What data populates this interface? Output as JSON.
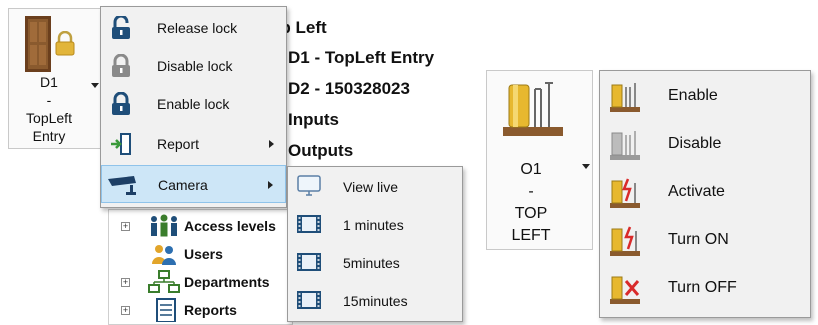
{
  "left": {
    "device_tile": {
      "label_lines": [
        "D1",
        "-",
        "TopLeft",
        "Entry"
      ]
    },
    "details": {
      "lines": [
        "op Left",
        "D1 - TopLeft Entry",
        "D2 - 150328023",
        "Inputs",
        "Outputs"
      ]
    },
    "lock_menu": {
      "items": [
        {
          "label": "Release lock",
          "icon": "lock-open-icon",
          "has_submenu": false
        },
        {
          "label": "Disable lock",
          "icon": "lock-disabled-icon",
          "has_submenu": false
        },
        {
          "label": "Enable lock",
          "icon": "lock-icon",
          "has_submenu": false
        },
        {
          "label": "Report",
          "icon": "report-door-icon",
          "has_submenu": true
        },
        {
          "label": "Camera",
          "icon": "camera-icon",
          "has_submenu": true,
          "selected": true
        }
      ]
    },
    "tree": {
      "items": [
        {
          "label": "Access levels",
          "icon": "people-icon",
          "expandable": true
        },
        {
          "label": "Users",
          "icon": "users-icon",
          "expandable": false
        },
        {
          "label": "Departments",
          "icon": "departments-icon",
          "expandable": true
        },
        {
          "label": "Reports",
          "icon": "reports-icon",
          "expandable": true
        }
      ]
    },
    "camera_menu": {
      "items": [
        {
          "label": "View live",
          "icon": "monitor-icon"
        },
        {
          "label": "1 minutes",
          "icon": "film-icon"
        },
        {
          "label": "5minutes",
          "icon": "film-icon"
        },
        {
          "label": "15minutes",
          "icon": "film-icon"
        }
      ]
    }
  },
  "right": {
    "output_tile": {
      "label_lines": [
        "O1",
        "-",
        "TOP",
        "LEFT"
      ]
    },
    "output_menu": {
      "items": [
        {
          "label": "Enable",
          "icon": "output-enable-icon"
        },
        {
          "label": "Disable",
          "icon": "output-disable-icon"
        },
        {
          "label": "Activate",
          "icon": "output-activate-icon"
        },
        {
          "label": "Turn ON",
          "icon": "output-turn-on-icon"
        },
        {
          "label": "Turn OFF",
          "icon": "output-turn-off-icon"
        }
      ]
    }
  },
  "colors": {
    "menu_bg": "#f1f1f1",
    "selection": "#cde6f7",
    "lock_blue": "#1f4e79",
    "camera_blue": "#1d3f66",
    "door_brown": "#7a4a22",
    "padlock_gold": "#e2b53a"
  }
}
